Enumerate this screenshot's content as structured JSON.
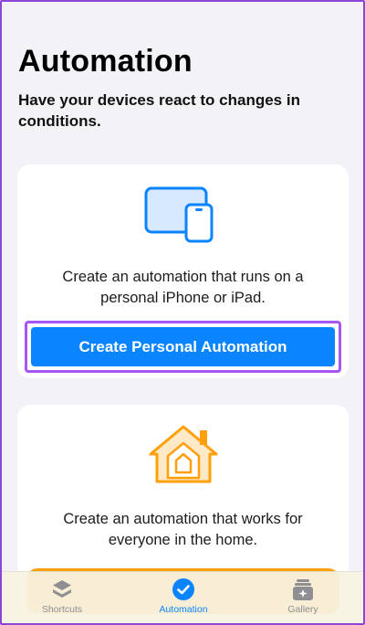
{
  "header": {
    "title": "Automation",
    "subtitle": "Have your devices react to changes in conditions."
  },
  "personal_card": {
    "icon": "devices-icon",
    "description": "Create an automation that runs on a personal iPhone or iPad.",
    "button_label": "Create Personal Automation",
    "accent_color": "#0a84ff",
    "highlight_color": "#a855f7"
  },
  "home_card": {
    "icon": "home-icon",
    "description": "Create an automation that works for everyone in the home.",
    "accent_color": "#ff9f0a"
  },
  "tabbar": {
    "tabs": [
      {
        "label": "Shortcuts",
        "icon": "shortcuts-stack-icon"
      },
      {
        "label": "Automation",
        "icon": "automation-check-icon",
        "selected": true
      },
      {
        "label": "Gallery",
        "icon": "gallery-icon"
      }
    ]
  }
}
